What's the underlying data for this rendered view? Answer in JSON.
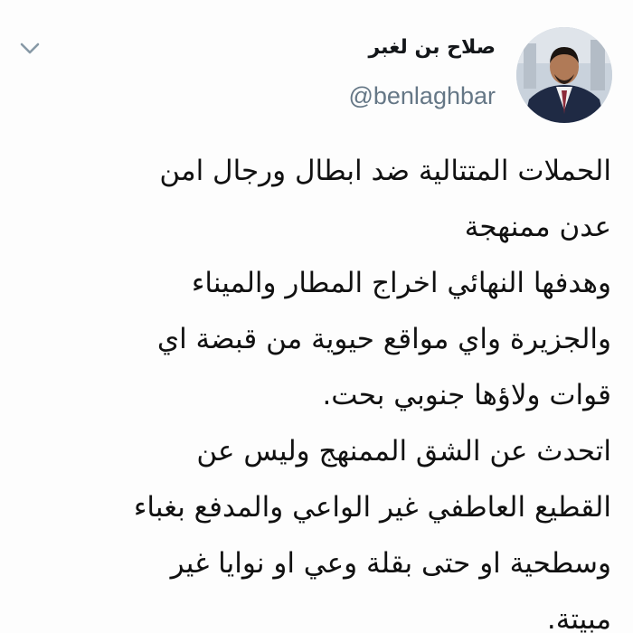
{
  "header": {
    "display_name": "صلاح بن لغبر",
    "handle": "@benlaghbar",
    "avatar_icon": "profile-photo",
    "menu_icon": "chevron-down-icon"
  },
  "tweet": {
    "lines": [
      "الحملات المتتالية ضد ابطال ورجال امن",
      "عدن ممنهجة",
      "وهدفها النهائي اخراج المطار والميناء",
      "والجزيرة واي مواقع حيوية من قبضة اي",
      "قوات ولاؤها جنوبي بحت.",
      "اتحدث عن الشق الممنهج  وليس عن",
      "القطيع العاطفي غير الواعي والمدفع بغباء",
      "وسطحية او حتى بقلة وعي او نوايا غير",
      "مبيتة."
    ]
  },
  "colors": {
    "name": "#14171a",
    "handle": "#657786",
    "text": "#111111",
    "caret": "#8899a6"
  }
}
